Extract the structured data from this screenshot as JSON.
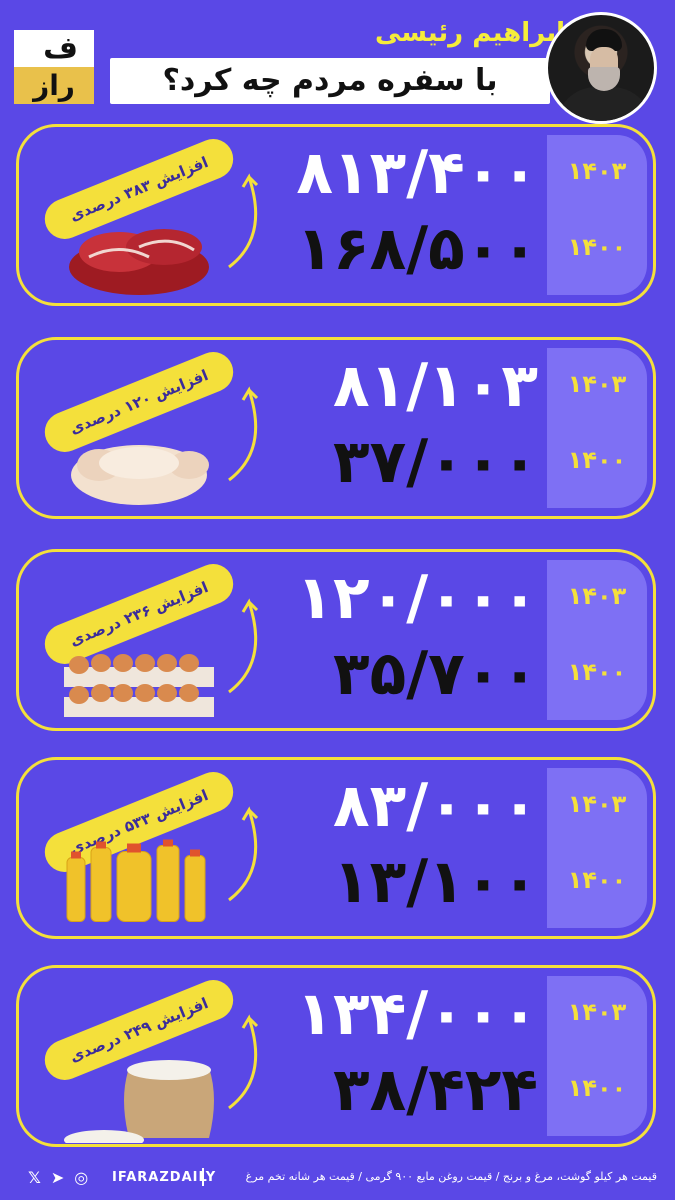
{
  "header": {
    "logo_top": "ف",
    "logo_bottom": "راز",
    "title_line1": "ابراهیم رئیسی",
    "title_line2": "با سفره مردم چه کرد؟"
  },
  "items": [
    {
      "icon": "meat-icon",
      "badge": "افزایش ۳۸۳ درصدی",
      "year_new": "۱۴۰۳",
      "year_old": "۱۴۰۰",
      "price_new": "۸۱۳/۴۰۰",
      "price_old": "۱۶۸/۵۰۰"
    },
    {
      "icon": "chicken-icon",
      "badge": "افزایش ۱۲۰ درصدی",
      "year_new": "۱۴۰۳",
      "year_old": "۱۴۰۰",
      "price_new": "۸۱/۱۰۳",
      "price_old": "۳۷/۰۰۰"
    },
    {
      "icon": "eggs-icon",
      "badge": "افزایش ۲۳۶ درصدی",
      "year_new": "۱۴۰۳",
      "year_old": "۱۴۰۰",
      "price_new": "۱۲۰/۰۰۰",
      "price_old": "۳۵/۷۰۰"
    },
    {
      "icon": "cooking-oil-icon",
      "badge": "افزایش ۵۳۳ درصدی",
      "year_new": "۱۴۰۳",
      "year_old": "۱۴۰۰",
      "price_new": "۸۳/۰۰۰",
      "price_old": "۱۳/۱۰۰"
    },
    {
      "icon": "rice-sack-icon",
      "badge": "افزایش ۲۴۹ درصدی",
      "year_new": "۱۴۰۳",
      "year_old": "۱۴۰۰",
      "price_new": "۱۳۴/۰۰۰",
      "price_old": "۳۸/۴۲۴"
    }
  ],
  "footer": {
    "social_icons": [
      "x-icon",
      "telegram-icon",
      "instagram-icon"
    ],
    "handle": "IFARAZDAILY",
    "note": "قیمت هر کیلو گوشت، مرغ و برنج / قیمت روغن مایع ۹۰۰ گرمی / قیمت هر شانه تخم مرغ"
  },
  "colors": {
    "background": "#5a48e6",
    "accent_yellow": "#f4e03b",
    "year_column": "#7e70f4"
  }
}
